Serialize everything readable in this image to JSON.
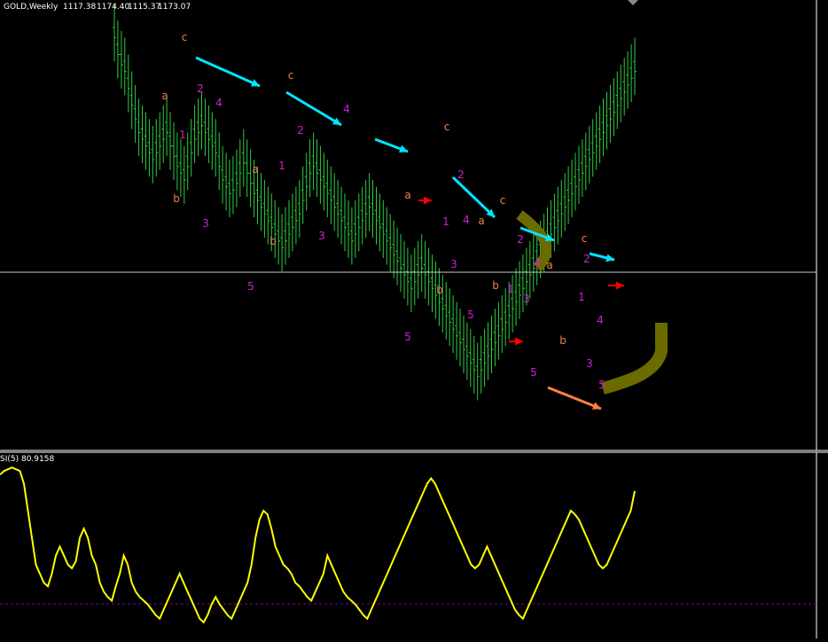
{
  "header": {
    "symbol_label": "GOLD,Weekly",
    "ohlc": [
      "1117.38",
      "1174.40",
      "1115.37",
      "1173.07"
    ]
  },
  "indicator": {
    "label": "SI(5) 80.9158"
  },
  "colors": {
    "background": "#000000",
    "candles": "#2ecc40",
    "rsi_line": "#ffff00",
    "current_price_line": "#c8c8c8",
    "panel_separator": "#ffffff",
    "rsi_level_line": "#8b008b",
    "label_orange": "#f0804a",
    "label_magenta": "#d020d0",
    "arrow_cyan": "#00e5ff",
    "arrow_red": "#ff0000",
    "arrow_salmon": "#ff8040",
    "curve_olive": "#6b6b00"
  },
  "chart_data": [
    {
      "type": "ohlc",
      "panel": "main",
      "title": "GOLD,Weekly",
      "note": "weekly price bars (approximate shape read from pixels; no price axis printed)",
      "current_price": 1173.07,
      "highs": [
        100,
        95,
        92,
        90,
        85,
        80,
        76,
        72,
        70,
        68,
        66,
        64,
        66,
        68,
        70,
        72,
        68,
        65,
        62,
        60,
        58,
        62,
        66,
        70,
        72,
        74,
        72,
        70,
        68,
        66,
        62,
        58,
        56,
        54,
        55,
        57,
        60,
        63,
        60,
        57,
        54,
        52,
        50,
        48,
        46,
        44,
        42,
        40,
        38,
        40,
        42,
        44,
        46,
        48,
        52,
        56,
        60,
        62,
        60,
        58,
        56,
        54,
        52,
        50,
        48,
        46,
        44,
        42,
        40,
        42,
        44,
        46,
        48,
        50,
        48,
        46,
        44,
        42,
        40,
        38,
        36,
        34,
        32,
        30,
        28,
        26,
        28,
        30,
        32,
        30,
        28,
        26,
        24,
        22,
        20,
        18,
        16,
        14,
        12,
        10,
        8,
        6,
        4,
        2,
        0,
        2,
        4,
        6,
        8,
        10,
        12,
        14,
        16,
        18,
        20,
        22,
        24,
        26,
        28,
        30,
        32,
        34,
        36,
        38,
        40,
        42,
        44,
        46,
        48,
        50,
        52,
        54,
        56,
        58,
        60,
        62,
        64,
        66,
        68,
        70,
        72,
        74,
        76,
        78,
        80,
        82,
        84,
        86,
        88,
        90
      ],
      "lows": [
        95,
        90,
        87,
        85,
        80,
        75,
        71,
        67,
        65,
        63,
        61,
        59,
        61,
        63,
        65,
        67,
        63,
        60,
        57,
        55,
        53,
        57,
        61,
        65,
        67,
        69,
        67,
        65,
        63,
        61,
        57,
        53,
        51,
        49,
        50,
        52,
        55,
        58,
        55,
        52,
        49,
        47,
        45,
        43,
        41,
        39,
        37,
        35,
        33,
        35,
        37,
        39,
        41,
        43,
        47,
        51,
        55,
        57,
        55,
        53,
        51,
        49,
        47,
        45,
        43,
        41,
        39,
        37,
        35,
        37,
        39,
        41,
        43,
        45,
        43,
        41,
        39,
        37,
        35,
        33,
        31,
        29,
        27,
        25,
        23,
        21,
        23,
        25,
        27,
        25,
        23,
        21,
        19,
        17,
        15,
        13,
        11,
        9,
        7,
        5,
        3,
        1,
        -1,
        -3,
        -5,
        -3,
        -1,
        1,
        3,
        5,
        7,
        9,
        11,
        13,
        15,
        17,
        19,
        21,
        23,
        25,
        27,
        29,
        31,
        33,
        35,
        37,
        39,
        41,
        43,
        45,
        47,
        49,
        51,
        53,
        55,
        57,
        59,
        61,
        63,
        65,
        67,
        69,
        71,
        73,
        75,
        77,
        79,
        81,
        83,
        85
      ]
    },
    {
      "type": "line",
      "panel": "indicator",
      "title": "SI(5)",
      "last_value": 80.9158,
      "level_line": 20,
      "ylim": [
        0,
        100
      ],
      "values": [
        90,
        92,
        93,
        94,
        93,
        92,
        85,
        70,
        55,
        40,
        35,
        30,
        28,
        35,
        45,
        50,
        45,
        40,
        38,
        42,
        55,
        60,
        55,
        45,
        40,
        30,
        25,
        22,
        20,
        28,
        35,
        45,
        40,
        30,
        25,
        22,
        20,
        18,
        15,
        12,
        10,
        15,
        20,
        25,
        30,
        35,
        30,
        25,
        20,
        15,
        10,
        8,
        12,
        18,
        22,
        18,
        15,
        12,
        10,
        15,
        20,
        25,
        30,
        40,
        55,
        65,
        70,
        68,
        60,
        50,
        45,
        40,
        38,
        35,
        30,
        28,
        25,
        22,
        20,
        25,
        30,
        35,
        45,
        40,
        35,
        30,
        25,
        22,
        20,
        18,
        15,
        12,
        10,
        15,
        20,
        25,
        30,
        35,
        40,
        45,
        50,
        55,
        60,
        65,
        70,
        75,
        80,
        85,
        88,
        85,
        80,
        75,
        70,
        65,
        60,
        55,
        50,
        45,
        40,
        38,
        40,
        45,
        50,
        45,
        40,
        35,
        30,
        25,
        20,
        15,
        12,
        10,
        15,
        20,
        25,
        30,
        35,
        40,
        45,
        50,
        55,
        60,
        65,
        70,
        68,
        65,
        60,
        55,
        50,
        45,
        40,
        38,
        40,
        45,
        50,
        55,
        60,
        65,
        70,
        80.9158
      ]
    }
  ],
  "wave_labels": {
    "orange": [
      {
        "text": "c"
      },
      {
        "text": "a"
      },
      {
        "text": "b"
      },
      {
        "text": "c"
      },
      {
        "text": "a"
      },
      {
        "text": "b"
      },
      {
        "text": "c"
      },
      {
        "text": "a"
      },
      {
        "text": "b"
      },
      {
        "text": "a"
      },
      {
        "text": "c"
      },
      {
        "text": "b"
      },
      {
        "text": "a"
      },
      {
        "text": "b"
      },
      {
        "text": "c"
      }
    ],
    "magenta": [
      {
        "text": "2"
      },
      {
        "text": "4"
      },
      {
        "text": "1"
      },
      {
        "text": "3"
      },
      {
        "text": "5"
      },
      {
        "text": "1"
      },
      {
        "text": "2"
      },
      {
        "text": "4"
      },
      {
        "text": "3"
      },
      {
        "text": "5"
      },
      {
        "text": "2"
      },
      {
        "text": "1"
      },
      {
        "text": "4"
      },
      {
        "text": "3"
      },
      {
        "text": "5"
      },
      {
        "text": "2"
      },
      {
        "text": "4"
      },
      {
        "text": "1"
      },
      {
        "text": "3"
      },
      {
        "text": "5"
      },
      {
        "text": "2"
      },
      {
        "text": "1"
      },
      {
        "text": "4"
      },
      {
        "text": "3"
      },
      {
        "text": "5"
      }
    ]
  }
}
